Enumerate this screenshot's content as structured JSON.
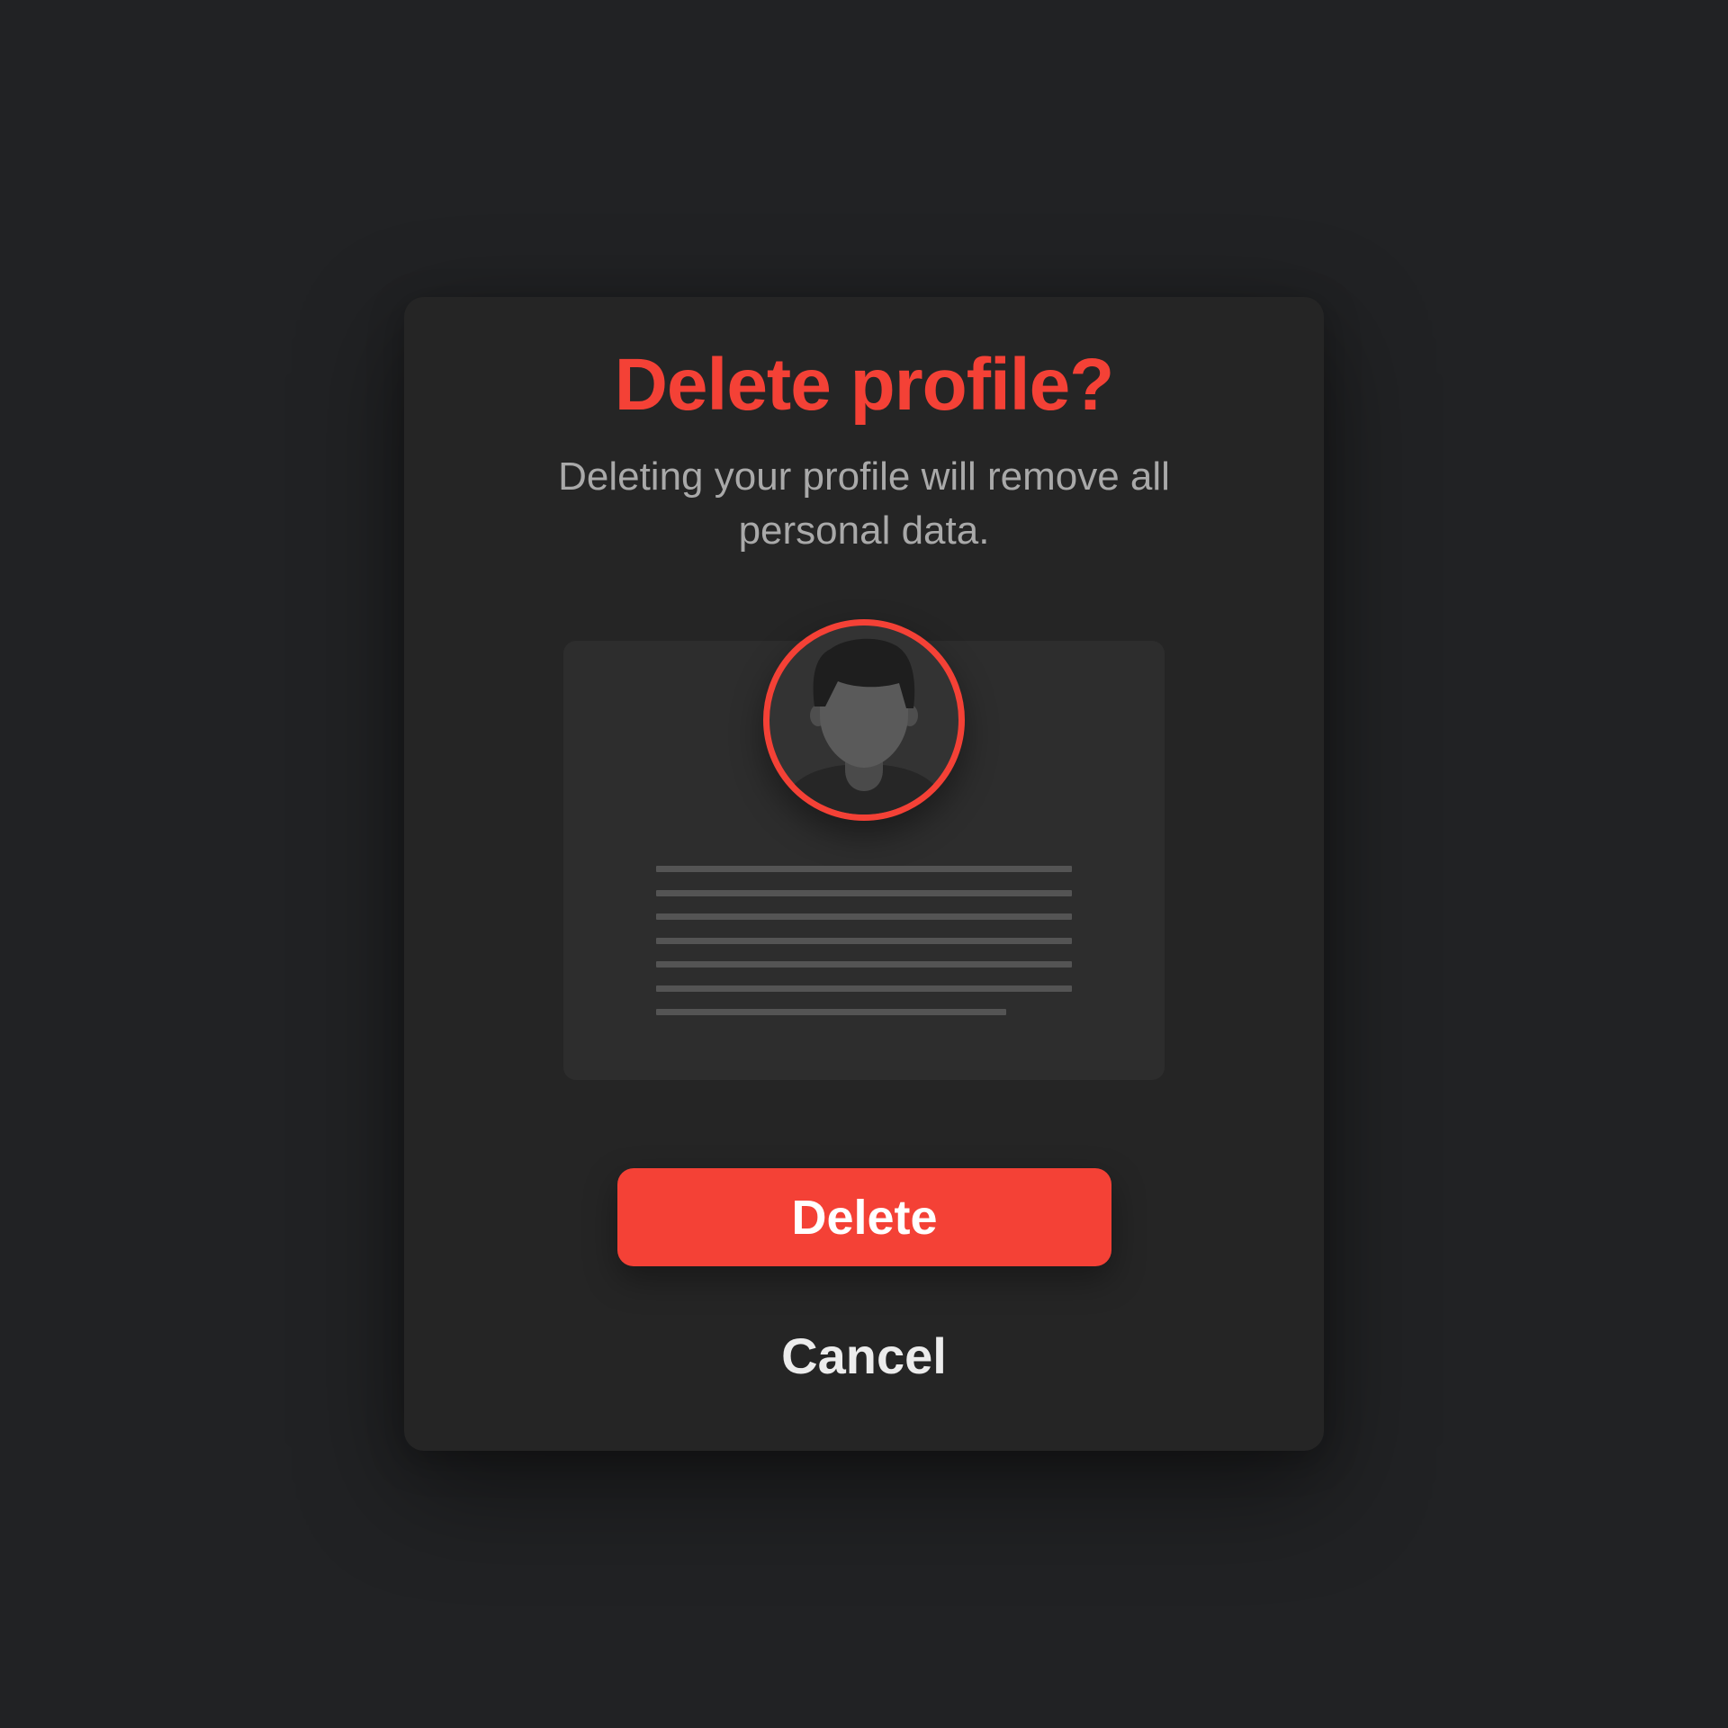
{
  "dialog": {
    "title": "Delete profile?",
    "description": "Deleting your profile will remove all personal data.",
    "illustration": {
      "avatar_icon": "user-avatar-icon",
      "placeholder_text_lines": 7
    },
    "primary_button": {
      "label": "Delete"
    },
    "secondary_button": {
      "label": "Cancel"
    }
  },
  "colors": {
    "background": "#212224",
    "modal": "#252525",
    "card": "#2d2d2d",
    "accent": "#f44136",
    "muted_text": "#a9a9a9",
    "line": "#545454"
  }
}
